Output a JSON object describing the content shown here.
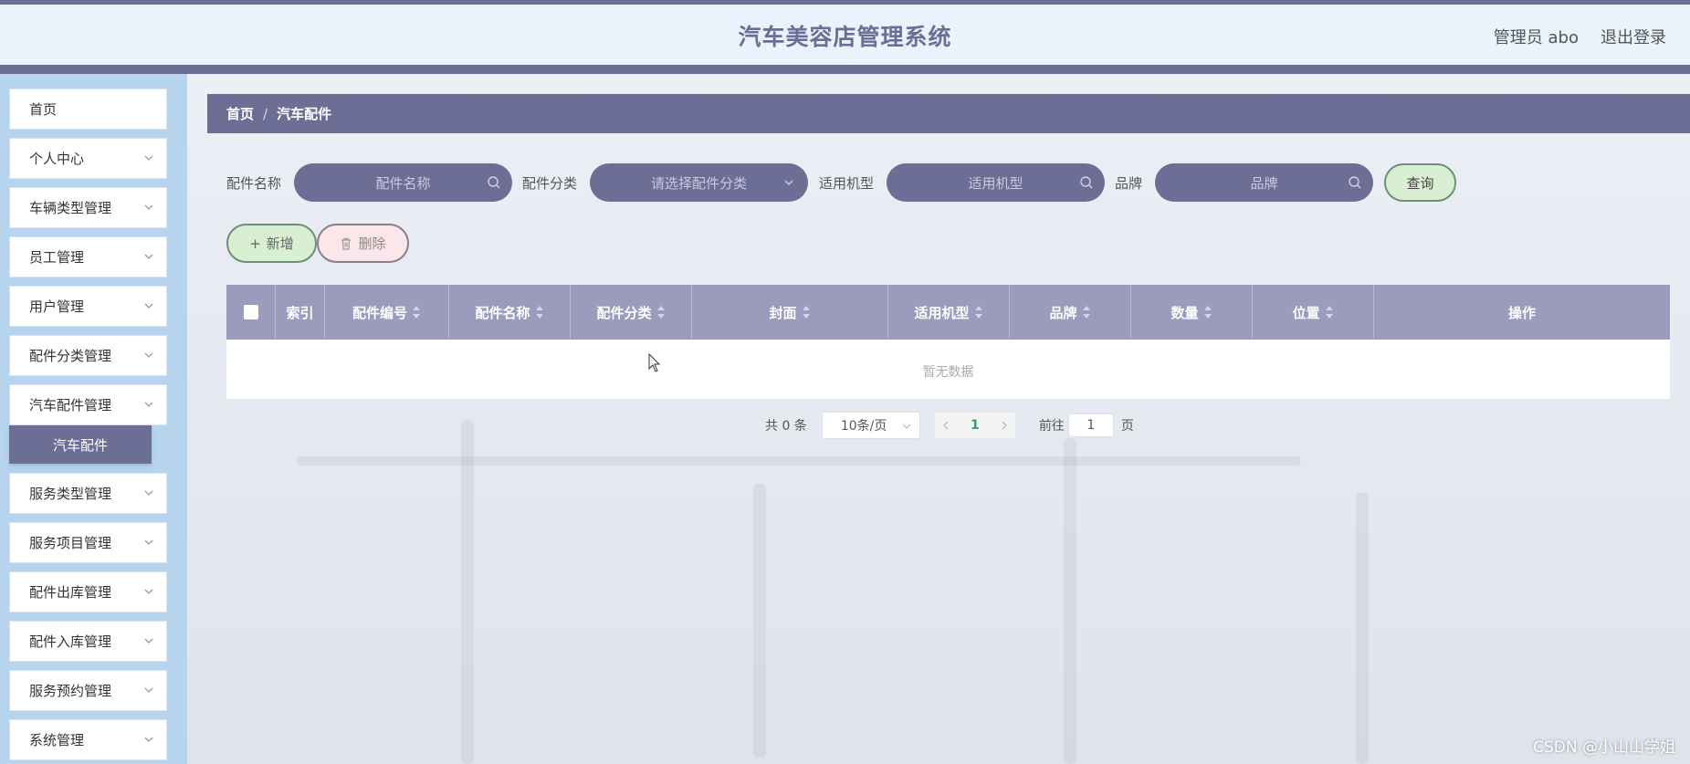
{
  "header": {
    "title": "汽车美容店管理系统",
    "user": "管理员 abo",
    "logout": "退出登录"
  },
  "sidebar": {
    "items": [
      {
        "label": "首页",
        "expandable": false
      },
      {
        "label": "个人中心",
        "expandable": true
      },
      {
        "label": "车辆类型管理",
        "expandable": true
      },
      {
        "label": "员工管理",
        "expandable": true
      },
      {
        "label": "用户管理",
        "expandable": true
      },
      {
        "label": "配件分类管理",
        "expandable": true
      },
      {
        "label": "汽车配件管理",
        "expandable": true
      },
      {
        "label": "服务类型管理",
        "expandable": true
      },
      {
        "label": "服务项目管理",
        "expandable": true
      },
      {
        "label": "配件出库管理",
        "expandable": true
      },
      {
        "label": "配件入库管理",
        "expandable": true
      },
      {
        "label": "服务预约管理",
        "expandable": true
      },
      {
        "label": "系统管理",
        "expandable": true
      }
    ],
    "active_sub_item": "汽车配件"
  },
  "breadcrumb": {
    "home": "首页",
    "separator": "/",
    "current": "汽车配件"
  },
  "search": {
    "part_name_label": "配件名称",
    "part_name_placeholder": "配件名称",
    "category_label": "配件分类",
    "category_placeholder": "请选择配件分类",
    "model_label": "适用机型",
    "model_placeholder": "适用机型",
    "brand_label": "品牌",
    "brand_placeholder": "品牌",
    "query_button": "查询"
  },
  "actions": {
    "add": "新增",
    "delete": "删除"
  },
  "table": {
    "columns": [
      "索引",
      "配件编号",
      "配件名称",
      "配件分类",
      "封面",
      "适用机型",
      "品牌",
      "数量",
      "位置",
      "操作"
    ],
    "rows": [],
    "empty_text": "暂无数据"
  },
  "pagination": {
    "total_text": "共 0 条",
    "page_size": "10条/页",
    "current_page": "1",
    "goto_label": "前往",
    "goto_value": "1",
    "page_suffix": "页"
  },
  "watermark": "CSDN @小山山学姐",
  "colors": {
    "primary": "#6d6e96",
    "header_bg": "#e8f3fb",
    "sidebar_bg": "#b6d4ee",
    "table_header": "#9a9bbd",
    "add_btn": "#d8efd1",
    "delete_btn": "#fbe6ea"
  }
}
